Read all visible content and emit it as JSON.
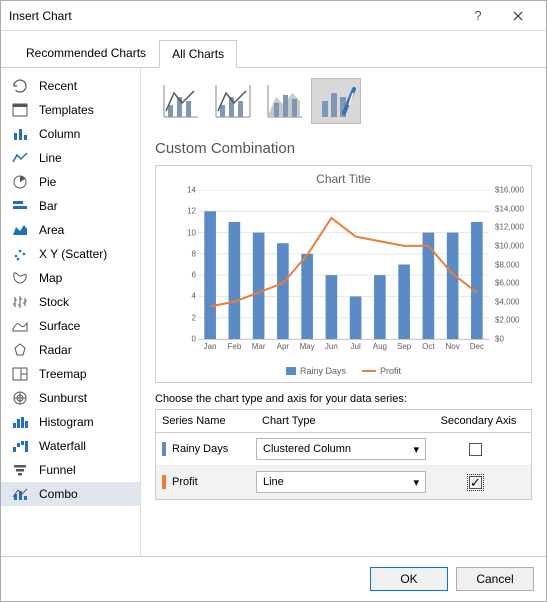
{
  "dialog": {
    "title": "Insert Chart"
  },
  "tabs": {
    "recommended": "Recommended Charts",
    "all": "All Charts"
  },
  "sidebar": {
    "items": [
      {
        "label": "Recent"
      },
      {
        "label": "Templates"
      },
      {
        "label": "Column"
      },
      {
        "label": "Line"
      },
      {
        "label": "Pie"
      },
      {
        "label": "Bar"
      },
      {
        "label": "Area"
      },
      {
        "label": "X Y (Scatter)"
      },
      {
        "label": "Map"
      },
      {
        "label": "Stock"
      },
      {
        "label": "Surface"
      },
      {
        "label": "Radar"
      },
      {
        "label": "Treemap"
      },
      {
        "label": "Sunburst"
      },
      {
        "label": "Histogram"
      },
      {
        "label": "Waterfall"
      },
      {
        "label": "Funnel"
      },
      {
        "label": "Combo"
      }
    ]
  },
  "section_title": "Custom Combination",
  "series_prompt": "Choose the chart type and axis for your data series:",
  "series_table": {
    "headers": {
      "name": "Series Name",
      "type": "Chart Type",
      "axis": "Secondary Axis"
    },
    "rows": [
      {
        "name": "Rainy Days",
        "type": "Clustered Column",
        "color": "#5a8bc6",
        "secondary": false
      },
      {
        "name": "Profit",
        "type": "Line",
        "color": "#ec7d32",
        "secondary": true
      }
    ]
  },
  "buttons": {
    "ok": "OK",
    "cancel": "Cancel"
  },
  "chart_data": {
    "type": "combo",
    "title": "Chart Title",
    "categories": [
      "Jan",
      "Feb",
      "Mar",
      "Apr",
      "May",
      "Jun",
      "Jul",
      "Aug",
      "Sep",
      "Oct",
      "Nov",
      "Dec"
    ],
    "series": [
      {
        "name": "Rainy Days",
        "type": "bar",
        "axis": "left",
        "color": "#5a8bc6",
        "values": [
          12,
          11,
          10,
          9,
          8,
          6,
          4,
          6,
          7,
          10,
          10,
          11
        ]
      },
      {
        "name": "Profit",
        "type": "line",
        "axis": "right",
        "color": "#ec7d32",
        "values": [
          3500,
          4000,
          5000,
          6000,
          9000,
          13000,
          11000,
          10500,
          10000,
          10000,
          7000,
          5000
        ]
      }
    ],
    "y_left": {
      "min": 0,
      "max": 14,
      "step": 2
    },
    "y_right": {
      "min": 0,
      "max": 16000,
      "step": 2000,
      "format": "currency"
    },
    "legend": [
      "Rainy Days",
      "Profit"
    ]
  }
}
